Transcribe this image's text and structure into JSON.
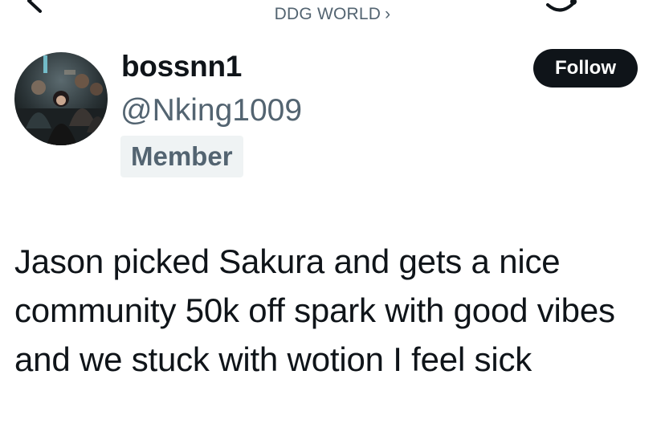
{
  "header": {
    "community_name": "DDG WORLD",
    "chevron": "›",
    "back_icon": "chevron-left-icon",
    "more_icon": "more-icon"
  },
  "author": {
    "display_name": "bossnn1",
    "handle": "@Nking1009",
    "role": "Member",
    "avatar": "group-photo-avatar"
  },
  "actions": {
    "follow_label": "Follow"
  },
  "post": {
    "text": "Jason picked Sakura and gets a nice community 50k off spark with good vibes and we stuck with wotion I feel sick"
  },
  "colors": {
    "text_primary": "#0f1419",
    "text_secondary": "#536471",
    "badge_bg": "#eff3f4",
    "follow_bg": "#0f1419"
  }
}
